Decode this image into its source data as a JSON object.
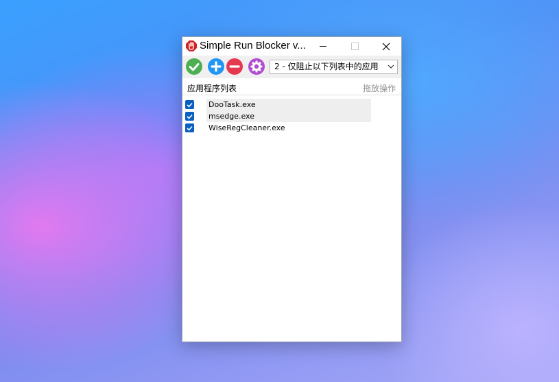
{
  "window": {
    "title": "Simple Run Blocker v...",
    "controls": {
      "minimize": "minimize",
      "maximize": "maximize",
      "close": "close"
    }
  },
  "toolbar": {
    "buttons": [
      {
        "name": "enable",
        "icon": "check-circle-icon",
        "color": "#4caf50"
      },
      {
        "name": "add",
        "icon": "plus-circle-icon",
        "color": "#2196f3"
      },
      {
        "name": "remove",
        "icon": "minus-circle-icon",
        "color": "#e53950"
      },
      {
        "name": "settings",
        "icon": "gear-icon",
        "color": "#b04ccf"
      }
    ],
    "mode_select": {
      "value": "2 - 仅阻止以下列表中的应用"
    }
  },
  "list_header": {
    "title": "应用程序列表",
    "hint": "拖放操作"
  },
  "apps": [
    {
      "name": "DooTask.exe",
      "checked": true,
      "highlighted": true
    },
    {
      "name": "msedge.exe",
      "checked": true,
      "highlighted": true
    },
    {
      "name": "WiseRegCleaner.exe",
      "checked": true,
      "highlighted": false
    }
  ]
}
